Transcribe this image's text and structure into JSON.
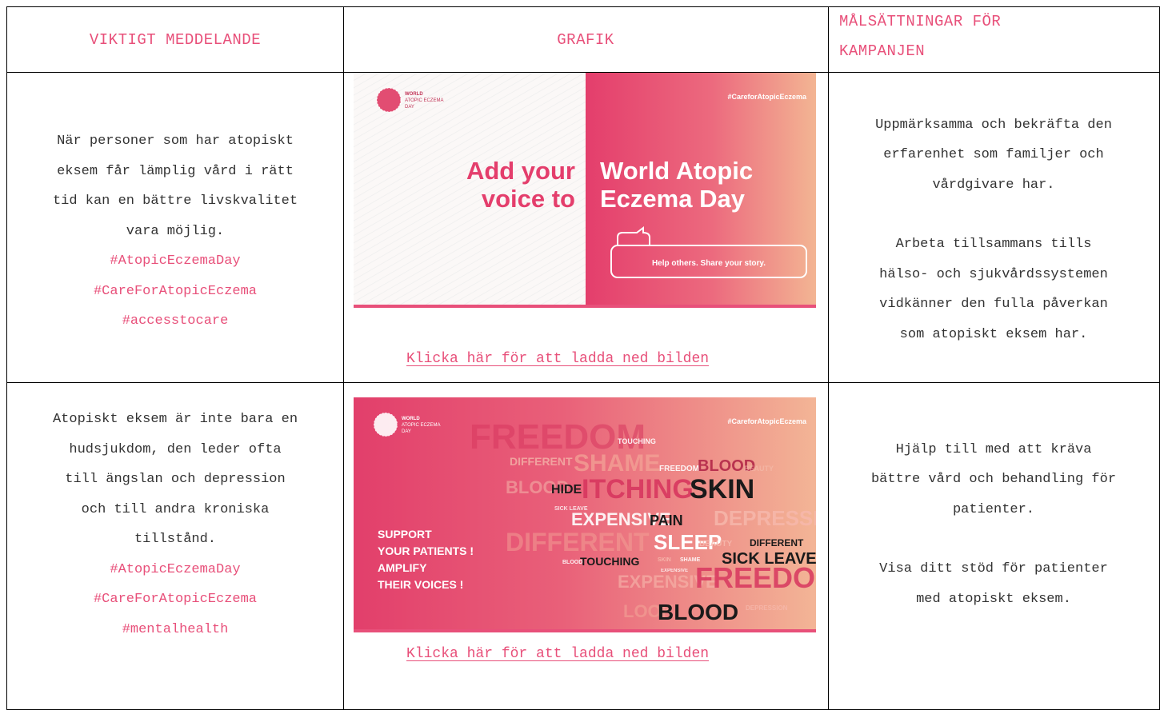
{
  "headers": {
    "message": "VIKTIGT MEDDELANDE",
    "graphic": "GRAFIK",
    "goals_line1": "MÅLSÄTTNINGAR FÖR",
    "goals_line2": "KAMPANJEN"
  },
  "rows": [
    {
      "message_lines": [
        "När personer som har atopiskt",
        "eksem får lämplig vård i rätt",
        "tid kan en bättre livskvalitet",
        "vara möjlig."
      ],
      "hashtags": [
        "#AtopicEczemaDay",
        "#CareForAtopicEczema",
        "#accesstocare"
      ],
      "download_link": "Klicka här för att ladda ned bilden",
      "goals": [
        [
          "Uppmärksamma och bekräfta den",
          "erfarenhet som familjer och",
          "vårdgivare har."
        ],
        [
          "Arbeta tillsammans tills",
          "hälso- och sjukvårdssystemen",
          "vidkänner den fulla påverkan",
          "som atopiskt eksem har."
        ]
      ],
      "graphic": {
        "logo_text": [
          "WORLD",
          "ATOPIC ECZEMA",
          "DAY"
        ],
        "hashtag": "#CareforAtopicEczema",
        "left_text": [
          "Add your",
          "voice to"
        ],
        "right_text": [
          "World Atopic",
          "Eczema Day"
        ],
        "bubble_text": "Help others. Share your story."
      }
    },
    {
      "message_lines": [
        "Atopiskt eksem är inte bara en",
        "hudsjukdom, den leder ofta",
        "till ängslan och depression",
        "och till andra kroniska",
        "tillstånd."
      ],
      "hashtags": [
        "#AtopicEczemaDay",
        "#CareForAtopicEczema",
        "#mentalhealth"
      ],
      "download_link": "Klicka här för att ladda ned bilden",
      "goals": [
        [
          "Hjälp till med att kräva",
          "bättre vård och behandling för",
          "patienter."
        ],
        [
          "Visa ditt stöd för patienter",
          "med atopiskt eksem."
        ]
      ],
      "graphic": {
        "logo_text": [
          "WORLD",
          "ATOPIC ECZEMA",
          "DAY"
        ],
        "hashtag": "#CareforAtopicEczema",
        "support_text": [
          "SUPPORT",
          "YOUR PATIENTS !",
          "AMPLIFY",
          "THEIR VOICES !"
        ],
        "words": [
          "FREEDOM",
          "TOUCHING",
          "DIFFERENT",
          "SHAME",
          "FREEDOM",
          "BLOOD",
          "BEAUTY",
          "BLOOD",
          "HIDE",
          "ITCHING",
          "SKIN",
          "SICK LEAVE",
          "EXPENSIVE",
          "PAIN",
          "DEPRESSION",
          "DIFFERENT",
          "SLEEP",
          "BEAUTY",
          "DIFFERENT",
          "BLOOD",
          "TOUCHING",
          "SKIN",
          "SHAME",
          "SICK LEAVE",
          "EXPENSIVE",
          "EXPENSIVE",
          "FREEDOM",
          "LOOK",
          "BLOOD",
          "DEPRESSION"
        ]
      }
    }
  ],
  "colors": {
    "accent": "#e8507a",
    "border": "#000000"
  }
}
